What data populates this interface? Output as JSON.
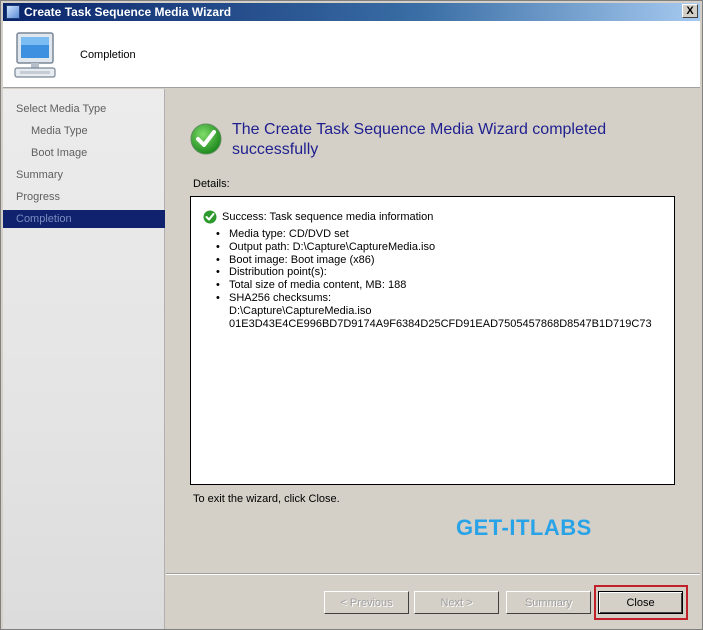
{
  "window": {
    "title": "Create Task Sequence Media Wizard",
    "close_glyph": "X"
  },
  "header": {
    "title": "Completion",
    "icon": "computer-icon"
  },
  "nav": {
    "items": [
      {
        "label": "Select Media Type",
        "level": 0,
        "active": false
      },
      {
        "label": "Media Type",
        "level": 1,
        "active": false
      },
      {
        "label": "Boot Image",
        "level": 1,
        "active": false
      },
      {
        "label": "Summary",
        "level": 0,
        "active": false
      },
      {
        "label": "Progress",
        "level": 0,
        "active": false
      },
      {
        "label": "Completion",
        "level": 0,
        "active": true
      }
    ]
  },
  "main": {
    "headline": "The Create Task Sequence Media Wizard completed successfully",
    "details_label": "Details:",
    "details": {
      "success": "Success: Task sequence media information",
      "bullets": [
        "Media type: CD/DVD set",
        "Output path: D:\\Capture\\CaptureMedia.iso",
        "Boot image: Boot image (x86)",
        "Distribution point(s):",
        "Total size of media content, MB:  188",
        "SHA256 checksums:"
      ],
      "checksum_file": "D:\\Capture\\CaptureMedia.iso",
      "checksum_value": "01E3D43E4CE996BD7D9174A9F6384D25CFD91EAD7505457868D8547B1D719C73"
    },
    "exit_text": "To exit the wizard, click Close.",
    "watermark": "GET-ITLABS"
  },
  "footer": {
    "previous": "< Previous",
    "next": "Next >",
    "summary": "Summary",
    "close": "Close"
  },
  "colors": {
    "nav_active_bg": "#10226d",
    "headline": "#1f1f8f",
    "watermark": "#29a3e8",
    "highlight": "#c0202a",
    "success_green": "#2e9a2e"
  }
}
